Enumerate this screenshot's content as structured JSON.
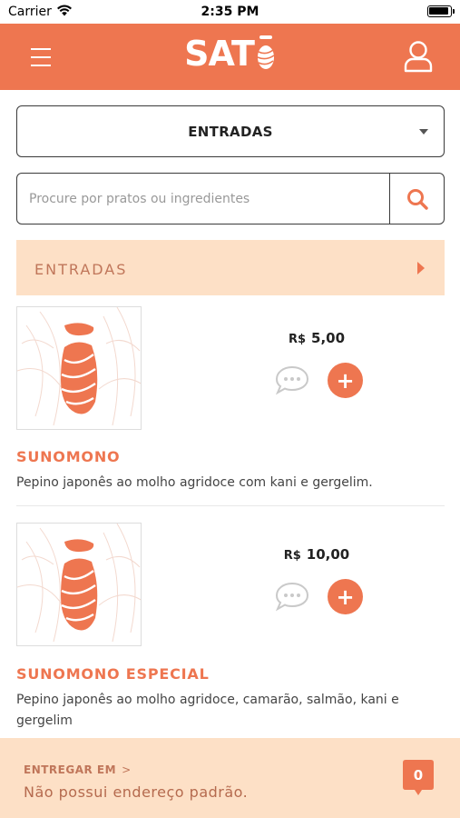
{
  "status_bar": {
    "carrier": "Carrier",
    "time": "2:35 PM"
  },
  "header": {
    "logo_text": "SAT",
    "accent_color": "#ee7650"
  },
  "category_select": {
    "selected": "ENTRADAS"
  },
  "search": {
    "placeholder": "Procure por pratos ou ingredientes",
    "value": ""
  },
  "section": {
    "title": "ENTRADAS"
  },
  "products": [
    {
      "price_currency": "R$",
      "price_value": "5,00",
      "name": "SUNOMONO",
      "description": "Pepino japonês ao molho agridoce com kani e gergelim."
    },
    {
      "price_currency": "R$",
      "price_value": "10,00",
      "name": "SUNOMONO ESPECIAL",
      "description": "Pepino japonês ao molho agridoce, camarão, salmão, kani e gergelim"
    }
  ],
  "footer": {
    "label": "ENTREGAR EM",
    "chevron": ">",
    "address": "Não possui endereço padrão.",
    "cart_count": "0"
  },
  "icons": [
    "wifi-icon",
    "battery-icon",
    "menu-icon",
    "user-icon",
    "dropdown-caret-icon",
    "search-icon",
    "chevron-right-icon",
    "comment-icon",
    "plus-icon",
    "cart-badge-icon"
  ]
}
